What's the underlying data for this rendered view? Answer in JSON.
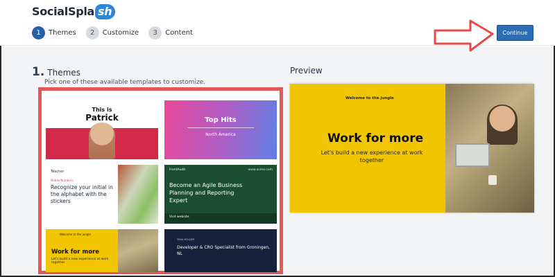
{
  "header": {
    "logo_text": "SocialSpla",
    "logo_badge": "sh",
    "continue_label": "Continue",
    "steps": [
      {
        "num": "1",
        "label": "Themes",
        "active": true
      },
      {
        "num": "2",
        "label": "Customize",
        "active": false
      },
      {
        "num": "3",
        "label": "Content",
        "active": false
      }
    ]
  },
  "themes": {
    "number": "1.",
    "title": "Themes",
    "subtitle": "Pick one of these available templates to customize."
  },
  "preview": {
    "title": "Preview",
    "brand": "Welcome to the jungle",
    "headline": "Work for more",
    "subline": "Let's build a new experience at work together"
  },
  "templates": [
    {
      "line1": "This is",
      "line2": "Patrick"
    },
    {
      "line1": "Top Hits",
      "line2": "North America"
    },
    {
      "brand": "Teacher",
      "tag": "Mobile Numbers",
      "text": "Recognize your initial in the alphabet with the stickers"
    },
    {
      "brand": "FrontAudit",
      "url": "www.acme.com",
      "text": "Become an Agile Business Planning and Reporting Expert",
      "footer": "Visit website"
    },
    {
      "brand": "Welcome to the jungle",
      "title": "Work for more",
      "text": "Let's build a new experience at work together"
    },
    {
      "name": "TIINA MOLDER",
      "text": "Developer & CRO Specialist from Groningen, NL"
    }
  ],
  "colors": {
    "accent": "#2f6db3",
    "highlight": "#e0595b",
    "yellow": "#f1c600"
  }
}
